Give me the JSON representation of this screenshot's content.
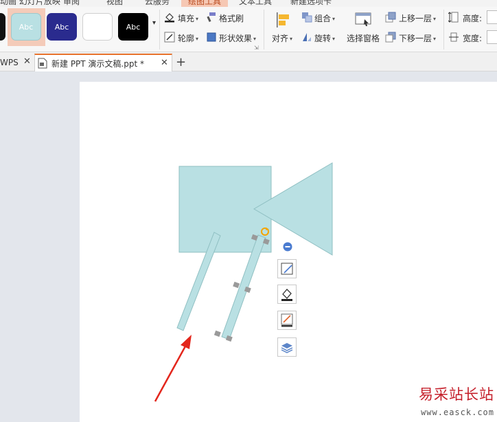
{
  "menu": {
    "tabs": [
      {
        "label": "动画 幻灯片放映"
      },
      {
        "label": "审阅"
      },
      {
        "label": "视图"
      },
      {
        "label": "云服务"
      },
      {
        "label": "绘图工具",
        "active": true
      },
      {
        "label": "文本工具"
      },
      {
        "label": "新建选项卡"
      }
    ]
  },
  "ribbon": {
    "style_swatches": [
      {
        "label": "",
        "bg": "#111111",
        "fg": "#ffffff"
      },
      {
        "label": "Abc",
        "bg": "#b9e0e3",
        "fg": "#ffffff",
        "selected": true
      },
      {
        "label": "Abc",
        "bg": "#2a2b8e",
        "fg": "#ffffff"
      },
      {
        "label": "",
        "bg": "#ffffff",
        "fg": "#333333"
      },
      {
        "label": "Abc",
        "bg": "#000000",
        "fg": "#ffffff"
      }
    ],
    "fill": "填充",
    "format_painter": "格式刷",
    "outline": "轮廓",
    "shape_effects": "形状效果",
    "align": "对齐",
    "group": "组合",
    "rotate": "旋转",
    "selection_pane": "选择窗格",
    "bring_forward": "上移一层",
    "send_backward": "下移一层",
    "height": "高度:",
    "width": "宽度:"
  },
  "doc_tabs": [
    {
      "label": "WPS"
    },
    {
      "label": "新建 PPT 演示文稿.ppt *",
      "active": true
    }
  ],
  "colors": {
    "accent": "#e8732c",
    "shape_fill": "#b9e0e3",
    "shape_stroke": "#8fbfc2",
    "arrow": "#e3261c",
    "handle": "#9a9a9a",
    "rotate_handle": "#f5a400"
  },
  "float_toolbar": {
    "items": [
      {
        "icon": "collapse-minus-icon"
      },
      {
        "icon": "edit-shape-icon"
      },
      {
        "icon": "fill-bucket-icon"
      },
      {
        "icon": "outline-pen-icon"
      },
      {
        "icon": "layers-icon"
      }
    ]
  },
  "watermark": {
    "title": "易采站长站",
    "url": "www.easck.com"
  }
}
